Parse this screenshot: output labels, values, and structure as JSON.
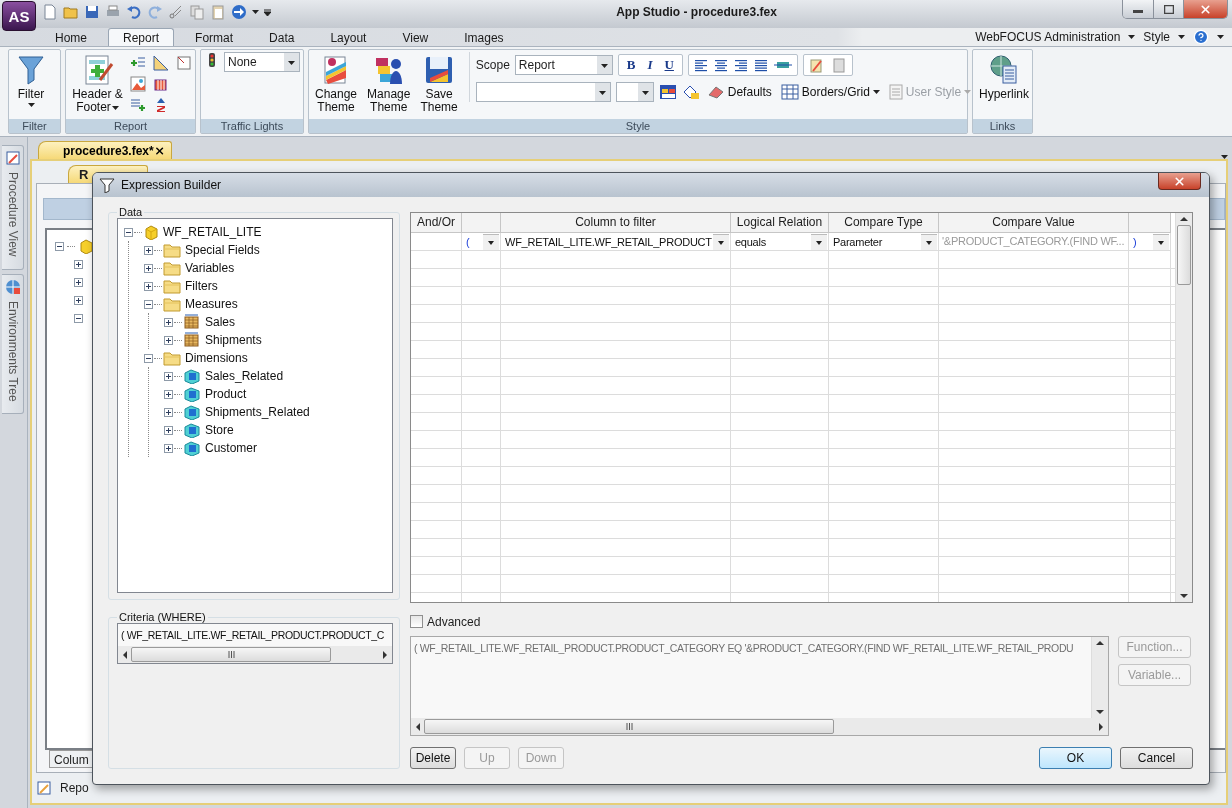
{
  "window": {
    "badge": "AS",
    "title": "App Studio - procedure3.fex"
  },
  "ribbon_tabs": [
    {
      "label": "Home",
      "selected": false
    },
    {
      "label": "Report",
      "selected": true
    },
    {
      "label": "Format",
      "selected": false
    },
    {
      "label": "Data",
      "selected": false
    },
    {
      "label": "Layout",
      "selected": false
    },
    {
      "label": "View",
      "selected": false
    },
    {
      "label": "Images",
      "selected": false
    }
  ],
  "ribbon_menus": [
    "WebFOCUS Administration",
    "Style"
  ],
  "ribbon_groups": [
    {
      "kind": "filter",
      "title": "Filter",
      "button": "Filter"
    },
    {
      "kind": "report",
      "title": "Report",
      "button": "Header & Footer"
    },
    {
      "kind": "traffic",
      "title": "Traffic Lights",
      "value": "None"
    },
    {
      "kind": "style",
      "title": "Style",
      "theme_buttons": [
        "Change Theme",
        "Manage Theme",
        "Save Theme"
      ],
      "scope_label": "Scope",
      "scope_value": "Report",
      "format_buttons": [
        "B",
        "I",
        "U"
      ],
      "actions": [
        {
          "label": "Defaults",
          "disabled": false,
          "menu": false
        },
        {
          "label": "Borders/Grid",
          "disabled": false,
          "menu": true
        },
        {
          "label": "User Style",
          "disabled": true,
          "menu": true
        }
      ]
    },
    {
      "kind": "links",
      "title": "Links",
      "button": "Hyperlink"
    }
  ],
  "side_panels": [
    "Procedure View",
    "Environments Tree"
  ],
  "document": {
    "tab": "procedure3.fex*",
    "sub_tab": "R",
    "bottom_tab": "Colum",
    "status": "Repo"
  },
  "dialog": {
    "title": "Expression Builder",
    "data_label": "Data",
    "tree": [
      {
        "label": "WF_RETAIL_LITE",
        "kind": "cube",
        "expanded": true,
        "children": [
          {
            "label": "Special Fields",
            "kind": "folder",
            "expanded": false
          },
          {
            "label": "Variables",
            "kind": "folder",
            "expanded": false
          },
          {
            "label": "Filters",
            "kind": "folder",
            "expanded": false
          },
          {
            "label": "Measures",
            "kind": "folder",
            "expanded": true,
            "children": [
              {
                "label": "Sales",
                "kind": "measure",
                "expanded": false
              },
              {
                "label": "Shipments",
                "kind": "measure",
                "expanded": false
              }
            ]
          },
          {
            "label": "Dimensions",
            "kind": "folder",
            "expanded": true,
            "children": [
              {
                "label": "Sales_Related",
                "kind": "dimension",
                "expanded": false
              },
              {
                "label": "Product",
                "kind": "dimension",
                "expanded": false
              },
              {
                "label": "Shipments_Related",
                "kind": "dimension",
                "expanded": false
              },
              {
                "label": "Store",
                "kind": "dimension",
                "expanded": false
              },
              {
                "label": "Customer",
                "kind": "dimension",
                "expanded": false
              }
            ]
          }
        ]
      }
    ],
    "criteria_label": "Criteria (WHERE)",
    "criteria": "( WF_RETAIL_LITE.WF_RETAIL_PRODUCT.PRODUCT_C",
    "grid": {
      "headers": {
        "and_or": "And/Or",
        "column": "Column to filter",
        "relation": "Logical Relation",
        "compare_type": "Compare Type",
        "compare_value": "Compare Value"
      },
      "rows": [
        {
          "open": "(",
          "column": "WF_RETAIL_LITE.WF_RETAIL_PRODUCT",
          "relation": "equals",
          "compare_type": "Parameter",
          "compare_value": "'&PRODUCT_CATEGORY.(FIND WF...",
          "close": ")"
        }
      ]
    },
    "advanced": {
      "label": "Advanced",
      "checked": false
    },
    "expression": "( WF_RETAIL_LITE.WF_RETAIL_PRODUCT.PRODUCT_CATEGORY EQ '&PRODUCT_CATEGORY.(FIND WF_RETAIL_LITE.WF_RETAIL_PRODU",
    "side_buttons": [
      {
        "label": "Function...",
        "disabled": true
      },
      {
        "label": "Variable...",
        "disabled": true
      }
    ],
    "actions": [
      {
        "label": "Delete",
        "disabled": false
      },
      {
        "label": "Up",
        "disabled": true
      },
      {
        "label": "Down",
        "disabled": true
      }
    ],
    "buttons": [
      {
        "label": "OK",
        "default": true
      },
      {
        "label": "Cancel",
        "default": false
      }
    ]
  }
}
